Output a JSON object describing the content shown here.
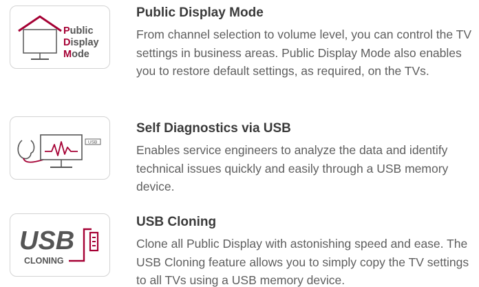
{
  "colors": {
    "accent": "#a50034",
    "text": "#5e5e5e",
    "heading": "#3a3a3a",
    "icon_gray": "#555555",
    "border": "#d3d3d3"
  },
  "features": [
    {
      "icon": "public-display-mode-icon",
      "icon_text": {
        "line1_initial": "P",
        "line1_rest": "ublic",
        "line2_initial": "D",
        "line2_rest": "isplay",
        "line3_initial": "M",
        "line3_rest": "ode"
      },
      "title": "Public Display Mode",
      "description": "From channel selection to volume level, you can control the TV settings in business areas. Public Display Mode also enables you to restore default settings, as required, on the TVs."
    },
    {
      "icon": "self-diagnostics-usb-icon",
      "icon_text": {
        "usb_tag": "USB"
      },
      "title": "Self Diagnostics via USB",
      "description": "Enables service engineers to analyze the data and identify technical issues quickly and easily through a USB memory device."
    },
    {
      "icon": "usb-cloning-icon",
      "icon_text": {
        "big": "USB",
        "small": "CLONING"
      },
      "title": "USB Cloning",
      "description": "Clone all Public Display with astonishing speed and ease. The USB Cloning feature allows you to simply copy the TV settings to all TVs using a USB memory device."
    }
  ]
}
